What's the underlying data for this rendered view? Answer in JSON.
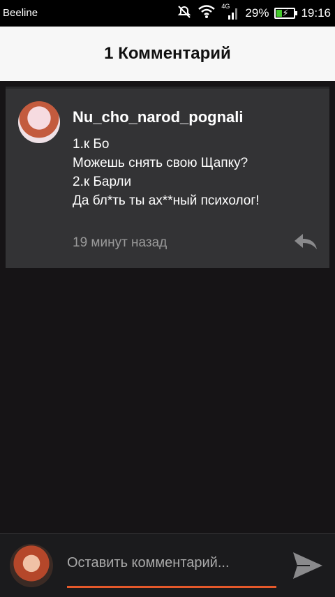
{
  "status_bar": {
    "carrier": "Beeline",
    "network": "4G",
    "battery_percent": "29%",
    "battery_level": 0.29,
    "time": "19:16",
    "icons": [
      "silent-icon",
      "wifi-icon",
      "signal-icon",
      "battery-icon"
    ]
  },
  "header": {
    "title": "1 Комментарий"
  },
  "comment": {
    "author": "Nu_cho_narod_pognali",
    "lines": [
      "1.к Бо",
      "Можешь снять свою Щапку?",
      "2.к Барли",
      "Да бл*ть ты ах**ный психолог!"
    ],
    "time_ago": "19 минут назад",
    "reply_icon": "reply-icon"
  },
  "composer": {
    "placeholder": "Оставить комментарий...",
    "send_icon": "send-icon",
    "accent_color": "#e4592b"
  }
}
